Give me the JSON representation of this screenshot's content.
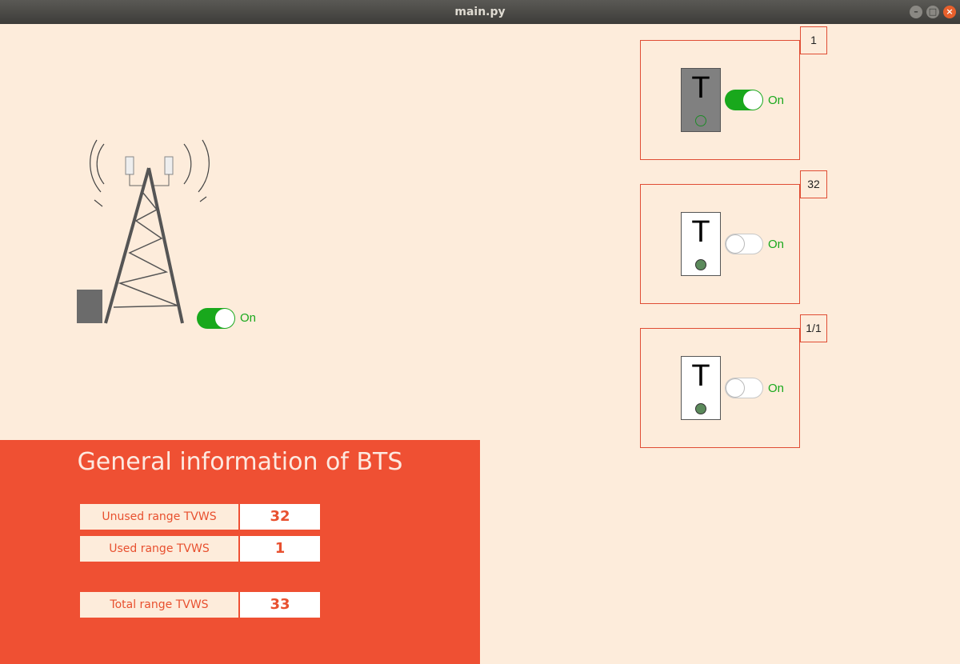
{
  "window": {
    "title": "main.py",
    "buttons": {
      "minimize": "–",
      "maximize": "□",
      "close": "×"
    }
  },
  "tower": {
    "toggle_state": "on",
    "toggle_label": "On"
  },
  "channels": [
    {
      "badge": "1",
      "letter": "T",
      "active": true,
      "toggle_state": "on",
      "toggle_label": "On"
    },
    {
      "badge": "32",
      "letter": "T",
      "active": false,
      "toggle_state": "off",
      "toggle_label": "On"
    },
    {
      "badge": "1/1",
      "letter": "T",
      "active": false,
      "toggle_state": "off",
      "toggle_label": "On"
    }
  ],
  "info": {
    "title": "General information of BTS",
    "rows": [
      {
        "label": "Unused range TVWS",
        "value": "32"
      },
      {
        "label": "Used range TVWS",
        "value": "1"
      },
      {
        "label": "Total range TVWS",
        "value": "33"
      }
    ]
  },
  "colors": {
    "accent": "#ef5033",
    "toggle_on": "#19a81c",
    "background": "#fdecdb"
  }
}
